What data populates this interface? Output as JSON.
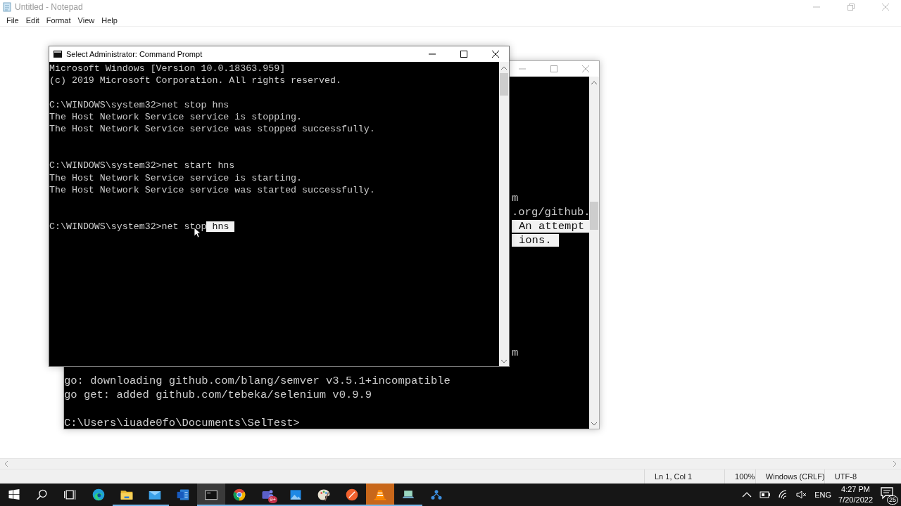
{
  "notepad": {
    "title": "Untitled - Notepad",
    "menu": [
      "File",
      "Edit",
      "Format",
      "View",
      "Help"
    ],
    "status_bar": [
      "Ln 1, Col 1",
      "100%",
      "Windows (CRLF)",
      "UTF-8"
    ]
  },
  "back_console": {
    "lines": [
      {
        "kind": "blank"
      },
      {
        "kind": "blank"
      },
      {
        "kind": "blank"
      },
      {
        "kind": "blank"
      },
      {
        "kind": "blank"
      },
      {
        "kind": "blank"
      },
      {
        "kind": "blank"
      },
      {
        "kind": "blank"
      },
      {
        "kind": "clipped",
        "text": "m",
        "selected": false
      },
      {
        "kind": "clipped",
        "text": ".org/github.",
        "selected": false
      },
      {
        "kind": "clipped",
        "text": "An attempt",
        "selected": true
      },
      {
        "kind": "clipped",
        "text": "ions.",
        "selected": true
      },
      {
        "kind": "blank"
      },
      {
        "kind": "blank"
      },
      {
        "kind": "blank"
      },
      {
        "kind": "blank"
      },
      {
        "kind": "blank"
      },
      {
        "kind": "blank"
      },
      {
        "kind": "blank"
      },
      {
        "kind": "clipped",
        "text": "m",
        "selected": false
      },
      {
        "kind": "blank"
      },
      {
        "kind": "text",
        "text": "go: downloading github.com/blang/semver v3.5.1+incompatible",
        "selected": false
      },
      {
        "kind": "text",
        "text": "go get: added github.com/tebeka/selenium v0.9.9",
        "selected": false
      },
      {
        "kind": "blank"
      },
      {
        "kind": "text",
        "text": "C:\\Users\\iuade0fo\\Documents\\SelTest>",
        "selected": false
      }
    ]
  },
  "front_console": {
    "title": "Select Administrator: Command Prompt",
    "lines": [
      {
        "kind": "text",
        "text": "Microsoft Windows [Version 10.0.18363.959]",
        "selected": false
      },
      {
        "kind": "text",
        "text": "(c) 2019 Microsoft Corporation. All rights reserved.",
        "selected": false
      },
      {
        "kind": "blank"
      },
      {
        "kind": "text",
        "text": "C:\\WINDOWS\\system32>net stop hns",
        "selected": false
      },
      {
        "kind": "text",
        "text": "The Host Network Service service is stopping.",
        "selected": false
      },
      {
        "kind": "text",
        "text": "The Host Network Service service was stopped successfully.",
        "selected": false
      },
      {
        "kind": "blank"
      },
      {
        "kind": "blank"
      },
      {
        "kind": "text",
        "text": "C:\\WINDOWS\\system32>net start hns",
        "selected": false
      },
      {
        "kind": "text",
        "text": "The Host Network Service service is starting.",
        "selected": false
      },
      {
        "kind": "text",
        "text": "The Host Network Service service was started successfully.",
        "selected": false
      },
      {
        "kind": "blank"
      },
      {
        "kind": "blank"
      },
      {
        "kind": "text",
        "text": "C:\\WINDOWS\\system32>net stop",
        "selected": false,
        "selection": "hns"
      }
    ]
  },
  "taskbar": {
    "items": [
      {
        "kind": "start",
        "selected": false,
        "running": false
      },
      {
        "kind": "search",
        "selected": false,
        "running": false
      },
      {
        "kind": "taskview",
        "selected": false,
        "running": false
      },
      {
        "kind": "edge",
        "selected": false,
        "running": false
      },
      {
        "kind": "folder",
        "selected": false,
        "running": true
      },
      {
        "kind": "mail",
        "selected": false,
        "running": true
      },
      {
        "kind": "word",
        "selected": false,
        "running": false
      },
      {
        "kind": "terminal",
        "selected": true,
        "running": true
      },
      {
        "kind": "chrome",
        "selected": false,
        "running": true
      },
      {
        "kind": "teams",
        "selected": false,
        "running": true,
        "badge": "9+"
      },
      {
        "kind": "photos",
        "selected": false,
        "running": true
      },
      {
        "kind": "paint",
        "selected": false,
        "running": true
      },
      {
        "kind": "orange",
        "selected": false,
        "running": true
      },
      {
        "kind": "cone",
        "selected": false,
        "running": true,
        "attention": true
      },
      {
        "kind": "laptop",
        "selected": false,
        "running": true
      },
      {
        "kind": "network",
        "selected": false,
        "running": false
      }
    ],
    "tray": {
      "language": "ENG",
      "time": "4:27 PM",
      "date": "7/20/2022",
      "notifications": "25"
    }
  }
}
